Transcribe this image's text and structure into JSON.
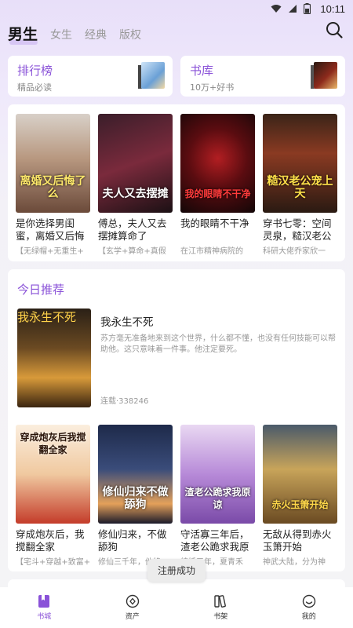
{
  "status_bar": {
    "time": "10:11",
    "icons": [
      "wifi-icon",
      "sim-icon",
      "battery-icon"
    ]
  },
  "top_tabs": [
    {
      "label": "男生",
      "active": true
    },
    {
      "label": "女生",
      "active": false
    },
    {
      "label": "经典",
      "active": false
    },
    {
      "label": "版权",
      "active": false
    }
  ],
  "entries": {
    "ranking": {
      "title": "排行榜",
      "subtitle": "精品必读"
    },
    "library": {
      "title": "书库",
      "subtitle": "10万+好书"
    }
  },
  "top_books": [
    {
      "title": "是你选择男闺蜜，离婚又后悔了",
      "desc": "【无绿帽+无重生+",
      "cover_text": "离婚又后悔了么"
    },
    {
      "title": "傅总，夫人又去摆摊算命了",
      "desc": "【玄学+算命+真假",
      "cover_text": "夫人又去摆摊"
    },
    {
      "title": "我的眼睛不干净",
      "desc": "在江市精神病院的",
      "cover_text": "我的眼睛不干净"
    },
    {
      "title": "穿书七零：空间灵泉，糙汉老公宠上天",
      "desc": "科研大佬乔家欣一",
      "cover_text": "糙汉老公宠上天"
    }
  ],
  "today": {
    "section_title": "今日推荐",
    "feature": {
      "title": "我永生不死",
      "desc": "苏方毫无准备地来到这个世界，什么都不懂，也没有任何技能可以帮助他。这只意味着一件事。他注定要死。",
      "stat": "连载·338246",
      "cover_text": "我永生不死"
    },
    "books": [
      {
        "title": "穿成炮灰后，我搅翻全家",
        "desc": "【宅斗+穿越+致富+",
        "cover_text": "穿成炮灰后我搅翻全家"
      },
      {
        "title": "修仙归来，不做舔狗",
        "desc": "修仙三千年，他终",
        "cover_text": "修仙归来不做舔狗"
      },
      {
        "title": "守活寡三年后，渣老公跪求我原谅",
        "desc": "结婚三年，夏青禾",
        "cover_text": "渣老公跪求我原谅"
      },
      {
        "title": "无敌从得到赤火玉箫开始",
        "desc": "神武大陆，分为神",
        "cover_text": "赤火玉箫开始"
      }
    ]
  },
  "toast": "注册成功",
  "bottom_nav": [
    {
      "label": "书城",
      "icon": "bookstore-icon",
      "active": true
    },
    {
      "label": "资产",
      "icon": "assets-icon",
      "active": false
    },
    {
      "label": "书架",
      "icon": "bookshelf-icon",
      "active": false
    },
    {
      "label": "我的",
      "icon": "profile-icon",
      "active": false
    }
  ],
  "colors": {
    "accent": "#8a52d8",
    "background_top": "#e8dff9",
    "card": "#ffffff"
  }
}
